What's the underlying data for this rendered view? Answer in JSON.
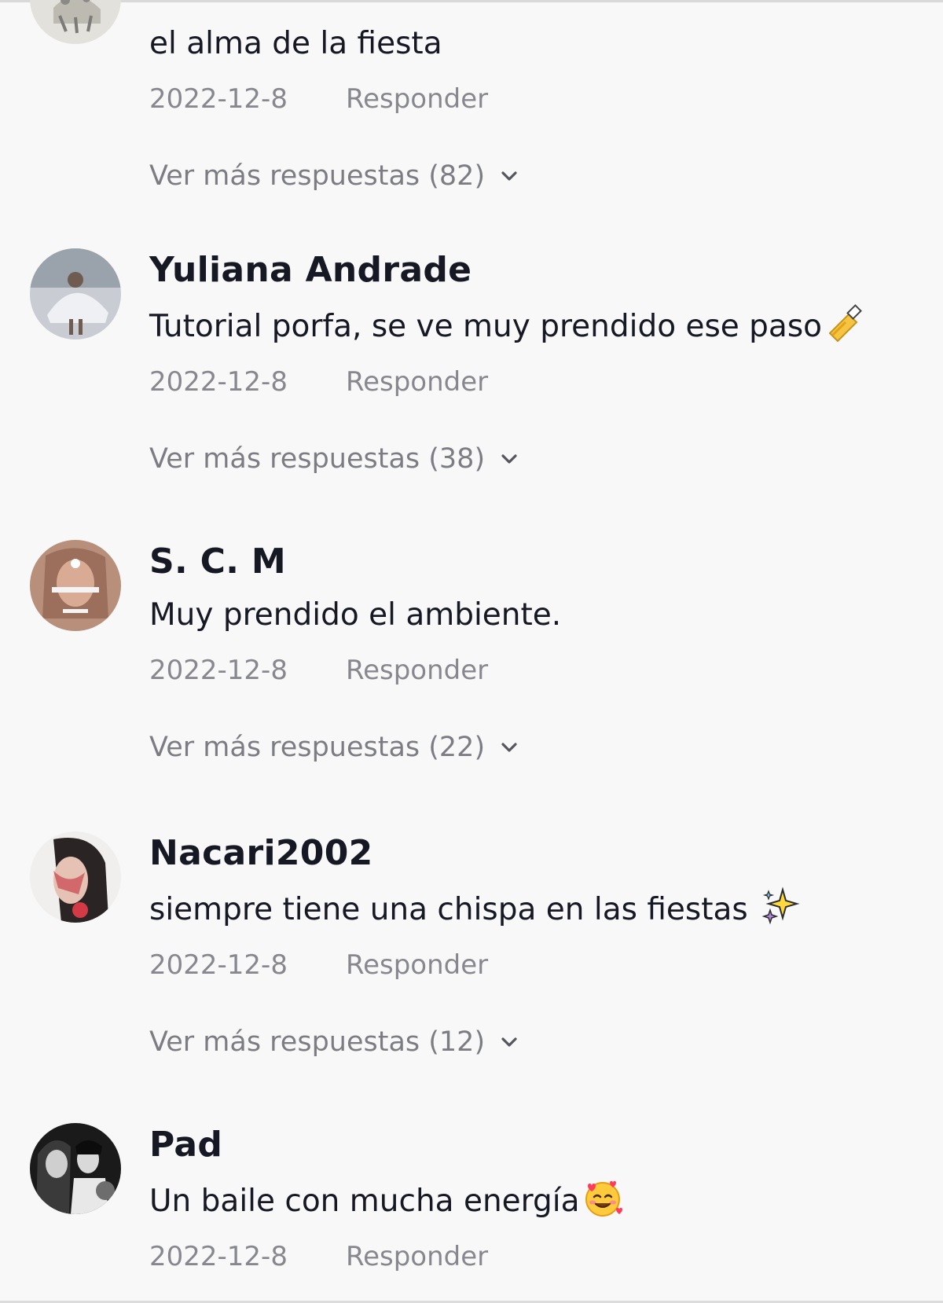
{
  "comments": [
    {
      "username": "",
      "text": "el alma de la fiesta",
      "date": "2022-12-8",
      "reply_label": "Responder",
      "more_replies": "Ver más respuestas (82)"
    },
    {
      "username": "Yuliana Andrade",
      "text": "Tutorial porfa, se ve muy prendido ese paso",
      "emoji": "nail-polish-emoji",
      "date": "2022-12-8",
      "reply_label": "Responder",
      "more_replies": "Ver más respuestas (38)"
    },
    {
      "username": "S. C. M",
      "text": "Muy prendido el ambiente.",
      "date": "2022-12-8",
      "reply_label": "Responder",
      "more_replies": "Ver más respuestas (22)"
    },
    {
      "username": "Nacari2002",
      "text": "siempre tiene una chispa en las fiestas ",
      "emoji": "sparkles-emoji",
      "date": "2022-12-8",
      "reply_label": "Responder",
      "more_replies": "Ver más respuestas (12)"
    },
    {
      "username": "Pad",
      "text": "Un baile con mucha energía",
      "emoji": "smiling-face-with-hearts-emoji",
      "date": "2022-12-8",
      "reply_label": "Responder"
    }
  ],
  "colors": {
    "background": "#f8f8f8",
    "text_primary": "#161823",
    "text_secondary": "rgba(22,24,35,0.5)"
  }
}
